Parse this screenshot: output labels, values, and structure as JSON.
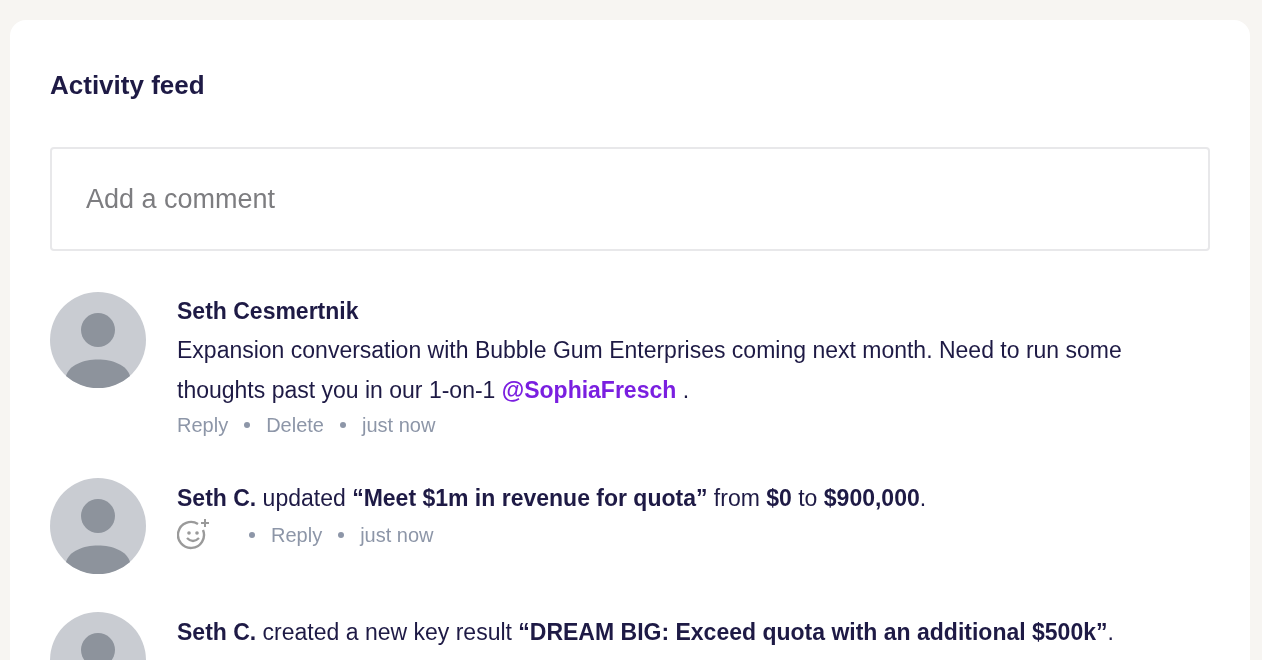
{
  "title": "Activity feed",
  "comment_field": {
    "placeholder": "Add a comment"
  },
  "entries": [
    {
      "kind": "comment",
      "author": "Seth Cesmertnik",
      "text": "Expansion conversation with Bubble Gum Enterprises coming next month. Need to run some thoughts past you in our 1-on-1",
      "mention": "@SophiaFresch",
      "text_after": ".",
      "actions": [
        {
          "kind": "link",
          "label": "Reply"
        },
        {
          "kind": "link",
          "label": "Delete"
        },
        {
          "kind": "time",
          "label": "just now"
        }
      ]
    },
    {
      "kind": "event",
      "text": "**Seth C.** updated **“Meet $1m in revenue for quota”** from **$0** to **$900,000**.",
      "actions": [
        {
          "kind": "reaction"
        },
        {
          "kind": "link",
          "label": "Reply"
        },
        {
          "kind": "time",
          "label": "just now"
        }
      ]
    },
    {
      "kind": "event",
      "text": "**Seth C.** created a new key result **“DREAM BIG: Exceed quota with an additional $500k”**."
    }
  ]
}
